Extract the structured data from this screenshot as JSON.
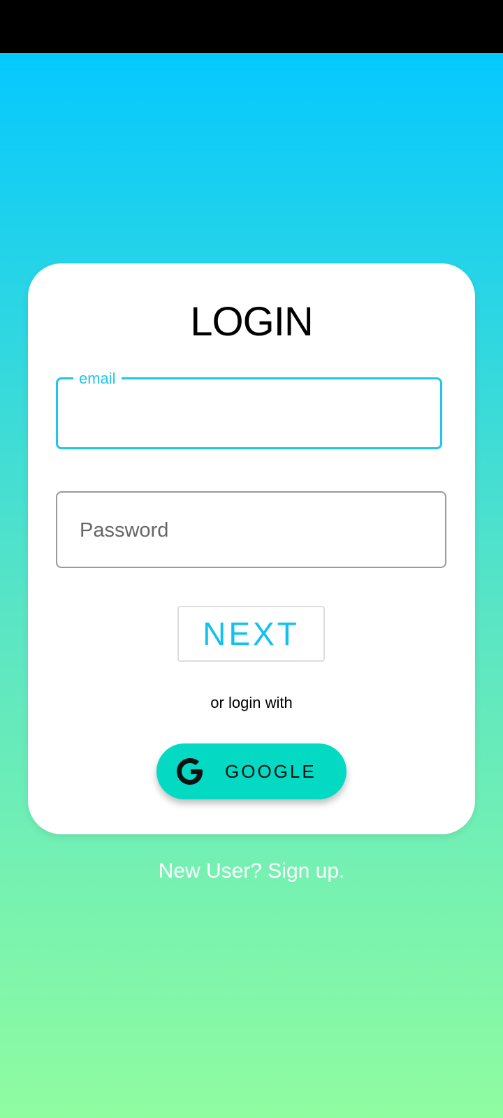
{
  "login": {
    "title": "LOGIN",
    "email": {
      "label": "email",
      "value": ""
    },
    "password": {
      "placeholder": "Password",
      "value": ""
    },
    "next_label": "NEXT",
    "or_text": "or login with",
    "google": {
      "label": "GOOGLE",
      "icon": "google-g-icon"
    }
  },
  "footer": {
    "signup_text": "New User? Sign up."
  },
  "colors": {
    "accent": "#1ec6ea",
    "google_button": "#04d9c4",
    "gradient_top": "#05c9fe",
    "gradient_bottom": "#8ffca0"
  }
}
